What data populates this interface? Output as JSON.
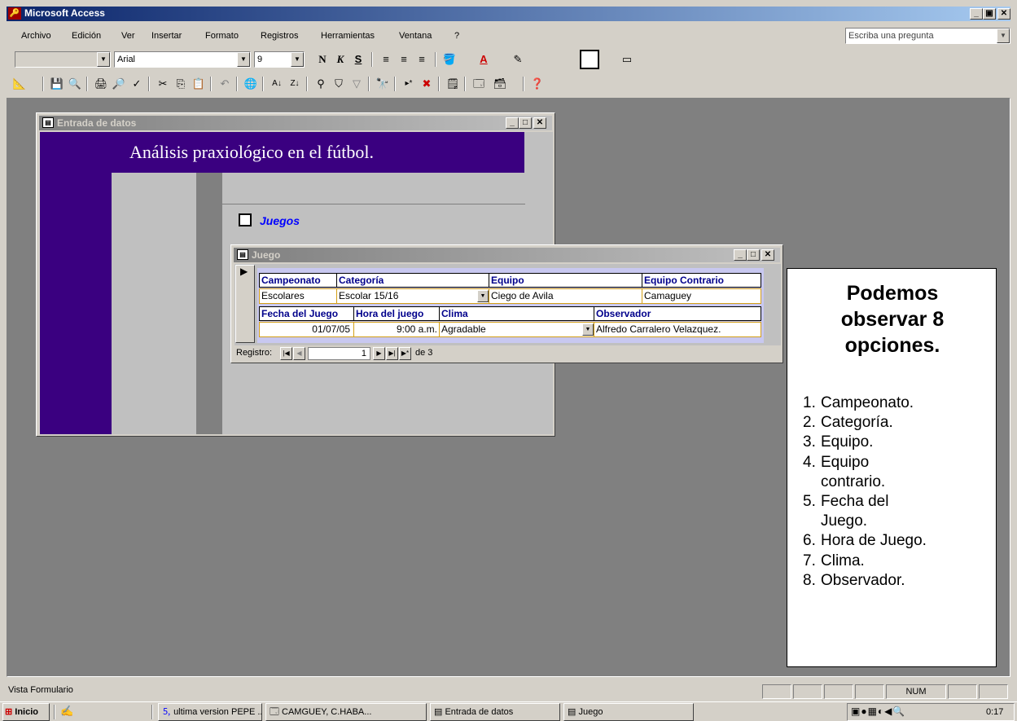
{
  "app": {
    "title": "Microsoft Access",
    "help_placeholder": "Escriba una pregunta"
  },
  "menu": {
    "items": [
      "Archivo",
      "Edición",
      "Ver",
      "Insertar",
      "Formato",
      "Registros",
      "Herramientas",
      "Ventana",
      "?"
    ]
  },
  "format_toolbar": {
    "object_value": "",
    "font": "Arial",
    "size": "9",
    "bold": "N",
    "italic": "K",
    "underline": "S"
  },
  "form_window": {
    "title": "Entrada de datos",
    "heading": "Análisis praxiológico en el fútbol.",
    "option_label": "Juegos",
    "colors": {
      "header_bg": "#3a0080",
      "body_bg": "#c0c0c0"
    }
  },
  "subform": {
    "title": "Juego",
    "headers_row1": [
      "Campeonato",
      "Categoría",
      "Equipo",
      "Equipo Contrario"
    ],
    "values_row1": [
      "Escolares",
      "Escolar 15/16",
      "Ciego de Avila",
      "Camaguey"
    ],
    "headers_row2": [
      "Fecha del Juego",
      "Hora del juego",
      "Clima",
      "Observador"
    ],
    "values_row2": [
      "01/07/05",
      "9:00 a.m.",
      "Agradable",
      "Alfredo Carralero Velazquez."
    ],
    "nav": {
      "label": "Registro:",
      "current": "1",
      "total": "de 3"
    }
  },
  "annotation": {
    "title": "Podemos observar 8 opciones.",
    "items": [
      "Campeonato.",
      "Categoría.",
      "Equipo.",
      "Equipo contrario.",
      "Fecha del Juego.",
      "Hora de Juego.",
      "Clima.",
      "Observador."
    ]
  },
  "statusbar": {
    "text": "Vista Formulario",
    "num": "NUM"
  },
  "taskbar": {
    "start": "Inicio",
    "tasks": [
      "ultima version PEPE ...",
      "CAMGUEY, C.HABA...",
      "Entrada de datos",
      "Juego"
    ],
    "clock": "0:17"
  }
}
